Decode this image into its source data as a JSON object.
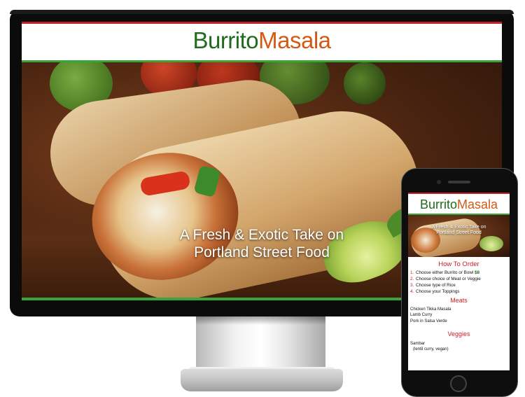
{
  "brand": {
    "part1": "Burrito",
    "part2": "Masala",
    "colors": {
      "burrito": "#1f6b1d",
      "masala": "#d35a14",
      "accent_red": "#c8202a",
      "accent_green": "#3aa53a"
    }
  },
  "desktop": {
    "hero_line1": "A Fresh & Exotic Take on",
    "hero_line2": "Portland Street Food"
  },
  "mobile": {
    "hero_line1": "A Fresh & Exotic Take on",
    "hero_line2": "Portland Street Food",
    "how_to_order": {
      "title": "How To Order",
      "steps": [
        {
          "num": "1.",
          "text": "Choose either Burrito or Bowl",
          "price": "$8"
        },
        {
          "num": "2.",
          "text": "Choose choice of Meat or Veggie"
        },
        {
          "num": "3.",
          "text": "Choose type of Rice"
        },
        {
          "num": "4.",
          "text": "Choose your Toppings"
        }
      ]
    },
    "meats": {
      "title": "Meats",
      "items": [
        "Chicken Tikka Masala",
        "Lamb Curry",
        "Pork in Salsa Verde"
      ]
    },
    "veggies": {
      "title": "Veggies",
      "items": [
        "Sambar",
        "(lentil curry, vegan)"
      ]
    }
  }
}
